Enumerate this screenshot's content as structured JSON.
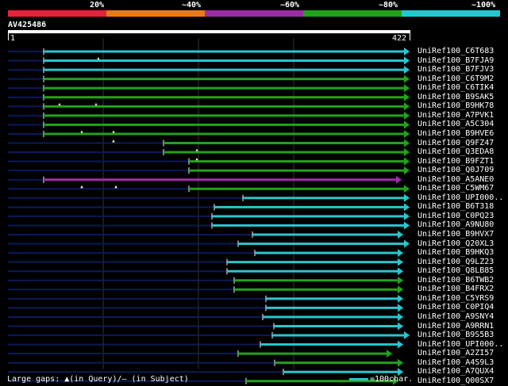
{
  "header": {
    "percent_labels": [
      "20%",
      "~40%",
      "~60%",
      "~80%",
      "~100%"
    ],
    "colors": [
      "#e8203a",
      "#e87a1a",
      "#9a2da6",
      "#22a21c",
      "#22c8d0"
    ]
  },
  "query": {
    "id": "AV425486",
    "start": "1",
    "end": "422"
  },
  "colors": {
    "cyan": "#2ac6ce",
    "green": "#22a21c",
    "purple": "#a02ca8",
    "navy": "#0a1a5a",
    "grid": "#333333"
  },
  "hits": [
    {
      "label": "UniRef100_C6T683",
      "color": "cyan"
    },
    {
      "label": "UniRef100_B7FJA9",
      "color": "cyan"
    },
    {
      "label": "UniRef100_B7FJV3",
      "color": "cyan"
    },
    {
      "label": "UniRef100_C6T9M2",
      "color": "green"
    },
    {
      "label": "UniRef100_C6TIK4",
      "color": "green"
    },
    {
      "label": "UniRef100_B9SAK5",
      "color": "green"
    },
    {
      "label": "UniRef100_B9HK78",
      "color": "green"
    },
    {
      "label": "UniRef100_A7PVK1",
      "color": "green"
    },
    {
      "label": "UniRef100_A5C304",
      "color": "green"
    },
    {
      "label": "UniRef100_B9HVE6",
      "color": "green"
    },
    {
      "label": "UniRef100_Q9FZ47",
      "color": "green"
    },
    {
      "label": "UniRef100_Q3EDA8",
      "color": "green"
    },
    {
      "label": "UniRef100_B9FZT1",
      "color": "green"
    },
    {
      "label": "UniRef100_Q0J709",
      "color": "green"
    },
    {
      "label": "UniRef100_A5ANE0",
      "color": "purple"
    },
    {
      "label": "UniRef100_C5WM67",
      "color": "green"
    },
    {
      "label": "UniRef100_UPI000..",
      "color": "cyan"
    },
    {
      "label": "UniRef100_B6T318",
      "color": "cyan"
    },
    {
      "label": "UniRef100_C0PQ23",
      "color": "cyan"
    },
    {
      "label": "UniRef100_A9NU80",
      "color": "cyan"
    },
    {
      "label": "UniRef100_B9HVX7",
      "color": "cyan"
    },
    {
      "label": "UniRef100_Q20XL3",
      "color": "cyan"
    },
    {
      "label": "UniRef100_B9HKQ3",
      "color": "cyan"
    },
    {
      "label": "UniRef100_Q9LZ23",
      "color": "cyan"
    },
    {
      "label": "UniRef100_Q8LB85",
      "color": "cyan"
    },
    {
      "label": "UniRef100_B6TWB2",
      "color": "green"
    },
    {
      "label": "UniRef100_B4FRX2",
      "color": "green"
    },
    {
      "label": "UniRef100_C5YRS9",
      "color": "cyan"
    },
    {
      "label": "UniRef100_C0PIQ4",
      "color": "cyan"
    },
    {
      "label": "UniRef100_A9SNY4",
      "color": "cyan"
    },
    {
      "label": "UniRef100_A9RRN1",
      "color": "cyan"
    },
    {
      "label": "UniRef100_B9S5B3",
      "color": "cyan"
    },
    {
      "label": "UniRef100_UPI000..",
      "color": "cyan"
    },
    {
      "label": "UniRef100_A2ZI57",
      "color": "green"
    },
    {
      "label": "UniRef100_A4S9L3",
      "color": "green"
    },
    {
      "label": "UniRef100_A7QUX4",
      "color": "cyan"
    },
    {
      "label": "UniRef100_Q00SX7",
      "color": "green"
    }
  ],
  "legend": {
    "text": "Large gaps: ▲(in Query)/– (in Subject)",
    "scale": "=100char."
  }
}
